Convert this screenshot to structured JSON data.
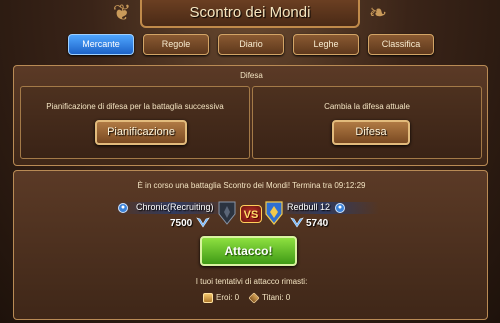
{
  "window": {
    "title": "Scontro dei Mondi"
  },
  "tabs": [
    {
      "label": "Mercante",
      "active": true
    },
    {
      "label": "Regole",
      "active": false
    },
    {
      "label": "Diario",
      "active": false
    },
    {
      "label": "Leghe",
      "active": false
    },
    {
      "label": "Classifica",
      "active": false
    }
  ],
  "defense": {
    "title": "Difesa",
    "planning_text": "Pianificazione di difesa per la battaglia successiva",
    "planning_button": "Pianificazione",
    "change_text": "Cambia la difesa attuale",
    "change_button": "Difesa"
  },
  "battle": {
    "status_text": "È in corso una battaglia Scontro dei Mondi! Termina tra 09:12:29",
    "vs_label": "VS",
    "left_player": {
      "name": "Chronic(Recruiting)",
      "score": "7500"
    },
    "right_player": {
      "name": "Redbull 12",
      "score": "5740"
    },
    "attack_button": "Attacco!",
    "attempts_label": "I tuoi tentativi di attacco rimasti:",
    "heroes_attempts": "Eroi: 0",
    "titans_attempts": "Titani: 0"
  },
  "colors": {
    "active_tab": "#1d63c8",
    "attack_green": "#3f9a16",
    "panel_brown": "#3f2718",
    "gold_border": "#c08a4a"
  },
  "icons": [
    "ornament-left-icon",
    "ornament-right-icon",
    "profile-icon",
    "wings-icon",
    "shield-icon",
    "hero-icon",
    "titan-icon"
  ]
}
